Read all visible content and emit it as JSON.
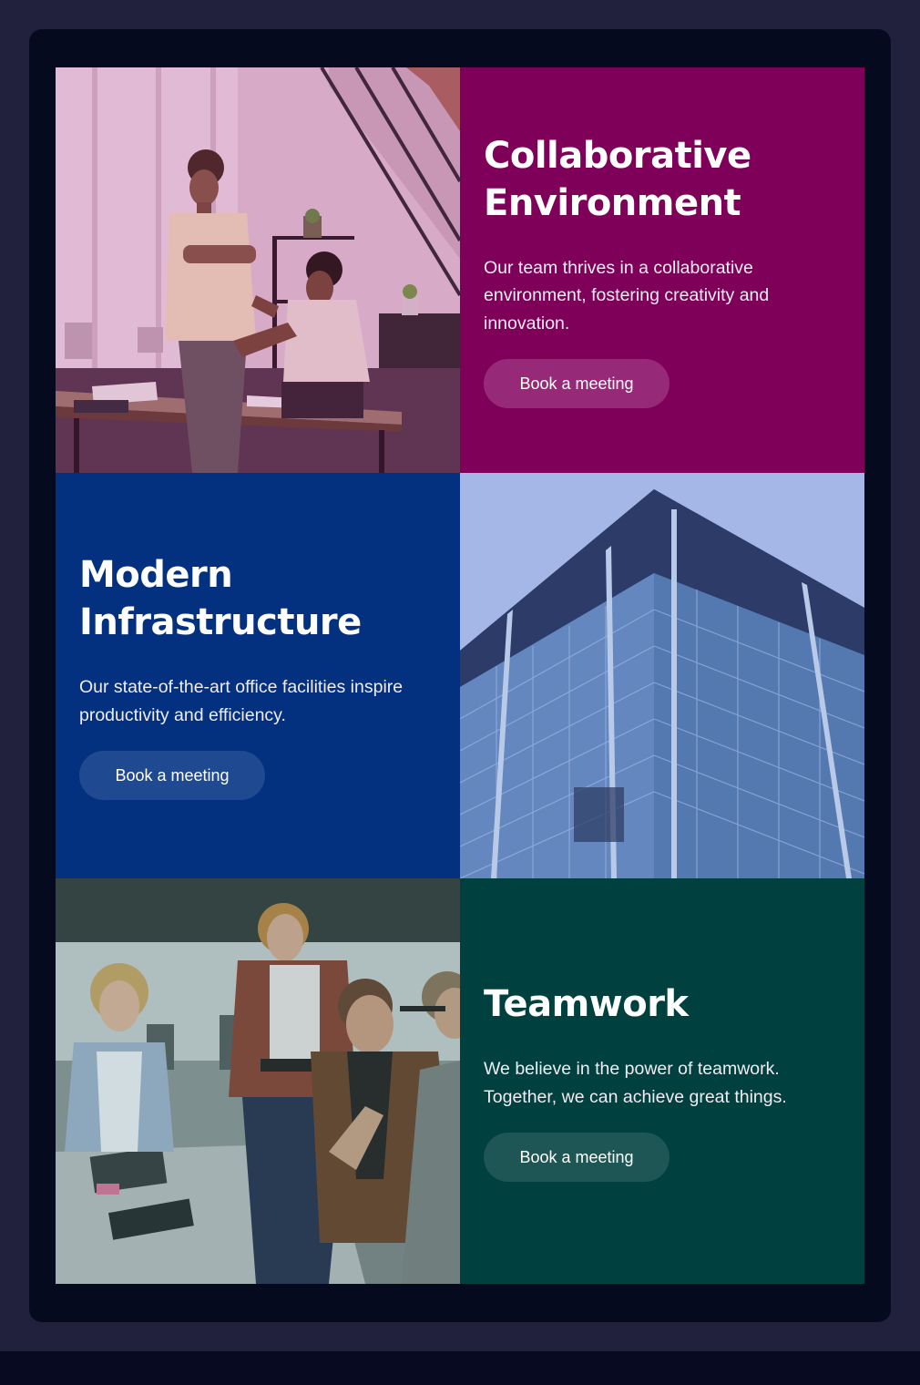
{
  "features": [
    {
      "title_line1": "Collaborative",
      "title_line2": "Environment",
      "description": "Our team thrives in a collaborative environment, fostering creativity and innovation.",
      "button_label": "Book a meeting",
      "image": "office-collaboration-photo",
      "accent_color": "#7e0059"
    },
    {
      "title_line1": "Modern",
      "title_line2": "Infrastructure",
      "description": "Our state-of-the-art office facilities inspire productivity and efficiency.",
      "button_label": "Book a meeting",
      "image": "glass-office-building-photo",
      "accent_color": "#03317f"
    },
    {
      "title_line1": "Teamwork",
      "title_line2": "",
      "description": "We believe in the power of teamwork. Together, we can achieve great things.",
      "button_label": "Book a meeting",
      "image": "team-meeting-photo",
      "accent_color": "#00403f"
    }
  ]
}
